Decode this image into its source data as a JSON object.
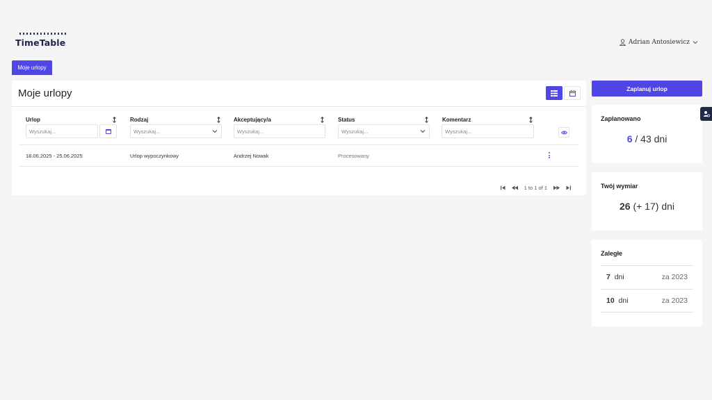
{
  "app": {
    "name": "TimeTable"
  },
  "user": {
    "name": "Adrian Antosiewicz"
  },
  "tabs": [
    {
      "label": "Moje urlopy"
    }
  ],
  "main": {
    "title": "Moje urlopy",
    "columns": [
      {
        "label": "Urlop",
        "placeholder": "Wyszukaj..."
      },
      {
        "label": "Rodzaj",
        "placeholder": "Wyszukaj..."
      },
      {
        "label": "Akceptujący/a",
        "placeholder": "Wyszukaj..."
      },
      {
        "label": "Status",
        "placeholder": "Wyszukaj..."
      },
      {
        "label": "Komentarz",
        "placeholder": "Wyszukaj..."
      }
    ],
    "rows": [
      {
        "urlop": "18.06.2025 - 25.06.2025",
        "rodzaj": "Urlop wypoczynkowy",
        "akceptujacy": "Andrzej Nowak",
        "status": "Procesowany",
        "komentarz": ""
      }
    ],
    "pagination": {
      "text": "1 to 1 of 1"
    }
  },
  "sidebar": {
    "plan_button": "Zaplanuj urlop",
    "planned": {
      "title": "Zaplanowano",
      "used": "6",
      "total": "/ 43 dni"
    },
    "allowance": {
      "title": "Twój wymiar",
      "base": "26",
      "extra": "(+ 17)",
      "unit": "dni"
    },
    "overdue": {
      "title": "Zaległe",
      "items": [
        {
          "days": "7",
          "unit": "dni",
          "year": "za 2023"
        },
        {
          "days": "10",
          "unit": "dni",
          "year": "za 2023"
        }
      ]
    }
  },
  "colors": {
    "accent": "#4f46e5",
    "background": "#f5f5f6"
  }
}
